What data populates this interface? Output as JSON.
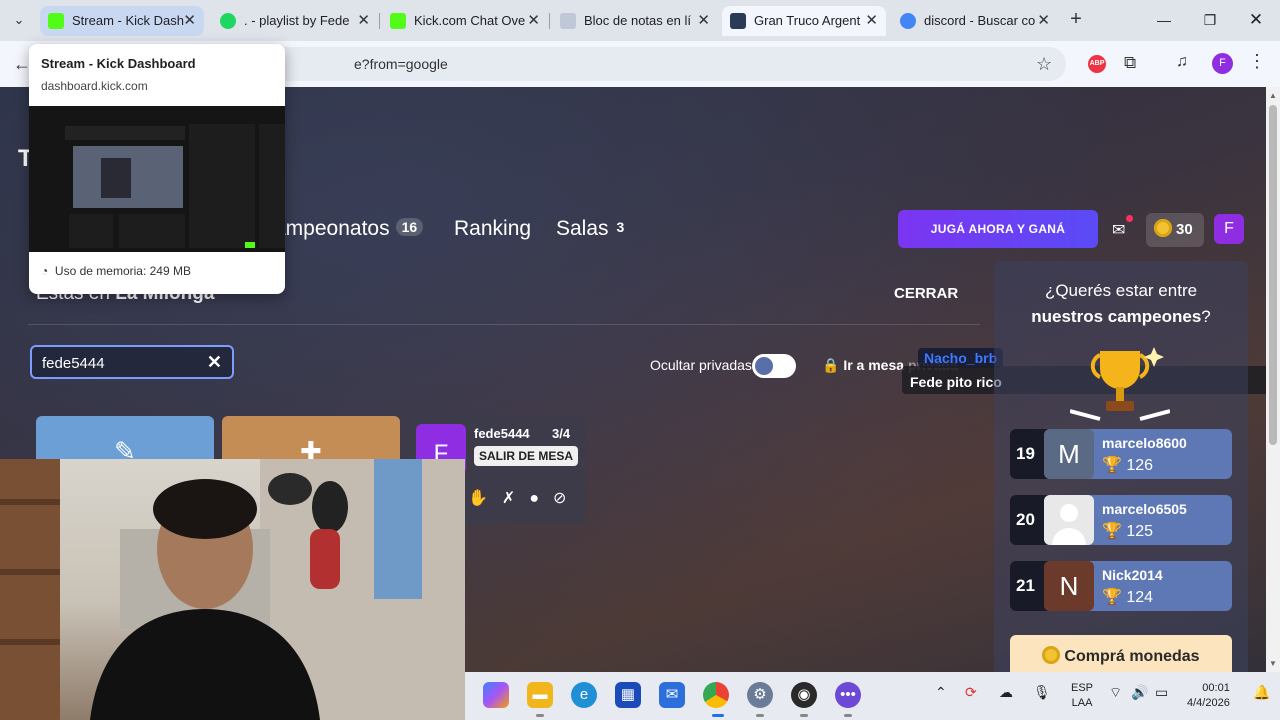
{
  "browser": {
    "tabs": [
      {
        "label": "Stream - Kick Dash",
        "favicon_color": "#53fc18",
        "state": "hovered"
      },
      {
        "label": ". - playlist by Fede",
        "favicon_color": "#1ed760",
        "state": "normal"
      },
      {
        "label": "Kick.com Chat Ove",
        "favicon_color": "#53fc18",
        "state": "normal"
      },
      {
        "label": "Bloc de notas en lí",
        "favicon_color": "#c0c8d8",
        "state": "normal"
      },
      {
        "label": "Gran Truco Argent",
        "favicon_color": "#2b3a55",
        "state": "active"
      },
      {
        "label": "discord - Buscar co",
        "favicon_color": "#4285f4",
        "state": "normal"
      }
    ],
    "address_fragment": "e?from=google",
    "profile_initial": "F",
    "abp_label": "ABP"
  },
  "hover_card": {
    "title": "Stream - Kick Dashboard",
    "domain": "dashboard.kick.com",
    "memory": "Uso de memoria: 249 MB"
  },
  "site": {
    "logo_letter": "T",
    "nav": [
      {
        "label": "ampeonatos",
        "badge": "16"
      },
      {
        "label": "Ranking",
        "badge": ""
      },
      {
        "label": "Salas",
        "badge": "3"
      }
    ],
    "play_button": "JUGÁ AHORA Y GANÁ",
    "coins": "30",
    "user_initial": "F",
    "colors": {
      "accent": "#7b35f0",
      "avatar": "#8e2de2",
      "link": "#3b79ff"
    }
  },
  "room": {
    "prefix": "Estás en ",
    "name": "La Milonga",
    "close": "CERRAR",
    "search_value": "fede5444",
    "hide_private": "Ocultar privadas",
    "go_private": "Ir a mesa",
    "go_private_faint": "privada"
  },
  "overlay": {
    "nacho": "Nacho_brb",
    "fede_msg": "Fede pito rico"
  },
  "table": {
    "avatar": "F",
    "name": "fede5444",
    "count": "3/4",
    "leave": "SALIR DE MESA"
  },
  "sidebar": {
    "question_1": "¿Querés estar entre",
    "question_2_bold": "nuestros campeones",
    "question_2_end": "?",
    "ranking": [
      {
        "rank": "19",
        "name": "marcelo8600",
        "score": "126",
        "avatar": "M",
        "avatar_color": "#5a6a84"
      },
      {
        "rank": "20",
        "name": "marcelo6505",
        "score": "125",
        "avatar": "",
        "avatar_color": "#e8e8e8"
      },
      {
        "rank": "21",
        "name": "Nick2014",
        "score": "124",
        "avatar": "N",
        "avatar_color": "#6b3a2a"
      }
    ],
    "buy_coins": "Comprá monedas"
  },
  "taskbar": {
    "lang_1": "ESP",
    "lang_2": "LAA",
    "time": "00:01",
    "date": "4/4/2026"
  }
}
